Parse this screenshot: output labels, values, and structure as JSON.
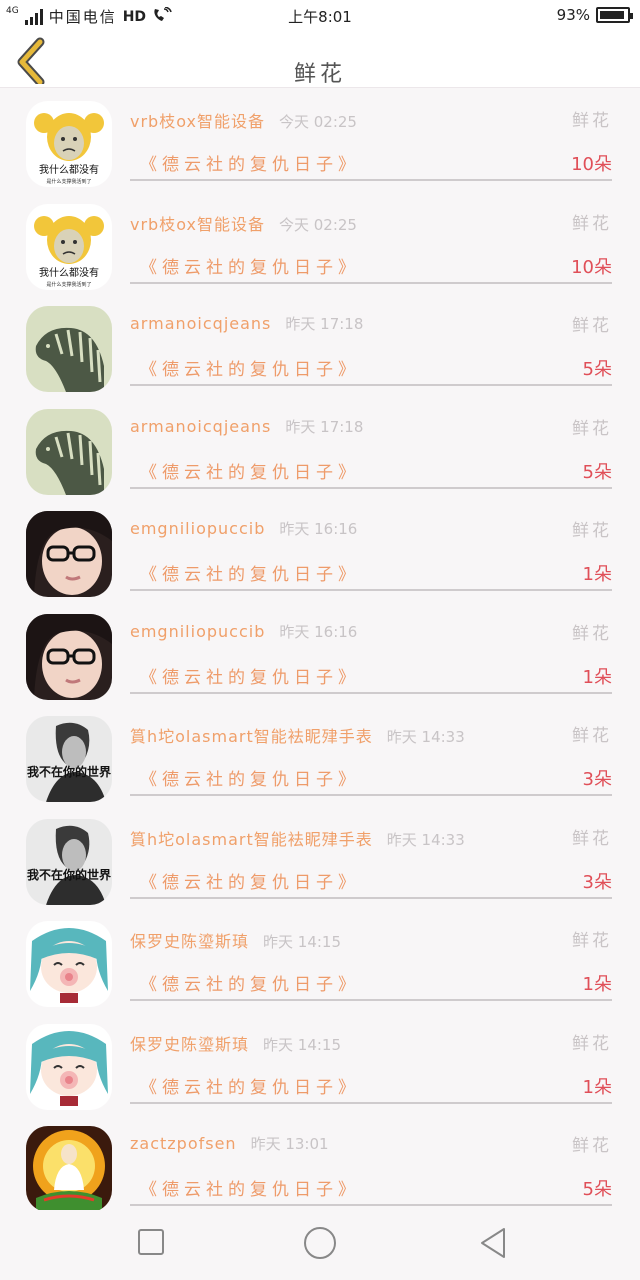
{
  "status_bar": {
    "network": "4G",
    "carrier": "中国电信",
    "hd": "HD",
    "time": "上午8:01",
    "battery": "93%",
    "battery_level": 0.93
  },
  "header": {
    "title": "鲜花"
  },
  "items": [
    {
      "name": "vrb枝ox智能设备",
      "time": "今天 02:25",
      "type": "鲜花",
      "work": "《德云社的复仇日子》",
      "count": "10朵",
      "avatar": "meme-girl-avatar"
    },
    {
      "name": "vrb枝ox智能设备",
      "time": "今天 02:25",
      "type": "鲜花",
      "work": "《德云社的复仇日子》",
      "count": "10朵",
      "avatar": "meme-girl-avatar"
    },
    {
      "name": "armanoicqjeans",
      "time": "昨天 17:18",
      "type": "鲜花",
      "work": "《德云社的复仇日子》",
      "count": "5朵",
      "avatar": "zebra-avatar"
    },
    {
      "name": "armanoicqjeans",
      "time": "昨天 17:18",
      "type": "鲜花",
      "work": "《德云社的复仇日子》",
      "count": "5朵",
      "avatar": "zebra-avatar"
    },
    {
      "name": "emgniliopuccib",
      "time": "昨天 16:16",
      "type": "鲜花",
      "work": "《德云社的复仇日子》",
      "count": "1朵",
      "avatar": "woman-glasses-avatar"
    },
    {
      "name": "emgniliopuccib",
      "time": "昨天 16:16",
      "type": "鲜花",
      "work": "《德云社的复仇日子》",
      "count": "1朵",
      "avatar": "woman-glasses-avatar"
    },
    {
      "name": "篔h坨olasmart智能袪眤肂手表",
      "time": "昨天 14:33",
      "type": "鲜花",
      "work": "《德云社的复仇日子》",
      "count": "3朵",
      "avatar": "man-bw-avatar"
    },
    {
      "name": "篔h坨olasmart智能袪眤肂手表",
      "time": "昨天 14:33",
      "type": "鲜花",
      "work": "《德云社的复仇日子》",
      "count": "3朵",
      "avatar": "man-bw-avatar"
    },
    {
      "name": "保罗史陈瑬斯瑱",
      "time": "昨天 14:15",
      "type": "鲜花",
      "work": "《德云社的复仇日子》",
      "count": "1朵",
      "avatar": "anime-girl-avatar"
    },
    {
      "name": "保罗史陈瑬斯瑱",
      "time": "昨天 14:15",
      "type": "鲜花",
      "work": "《德云社的复仇日子》",
      "count": "1朵",
      "avatar": "anime-girl-avatar"
    },
    {
      "name": "zactzpofsen",
      "time": "昨天 13:01",
      "type": "鲜花",
      "work": "《德云社的复仇日子》",
      "count": "5朵",
      "avatar": "buddha-avatar"
    }
  ],
  "avatar_texts": {
    "meme_caption": "我什么都没有",
    "meme_sub": "是什么支撑我活到了",
    "man_caption": "我不在你的世界"
  },
  "nav": {
    "icons": [
      "square-recent-icon",
      "circle-home-icon",
      "triangle-back-icon"
    ]
  },
  "colors": {
    "name": "#f0a06a",
    "count": "#e04f58",
    "muted": "#c8c4c6",
    "back_arrow": "#e6b93a"
  }
}
